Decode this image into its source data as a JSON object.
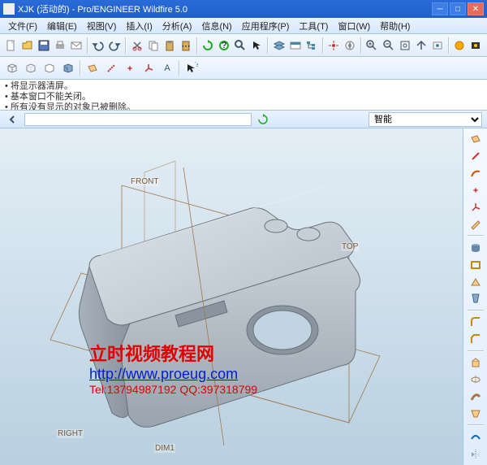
{
  "title": "XJK (活动的) - Pro/ENGINEER Wildfire 5.0",
  "menu": [
    "文件(F)",
    "编辑(E)",
    "视图(V)",
    "插入(I)",
    "分析(A)",
    "信息(N)",
    "应用程序(P)",
    "工具(T)",
    "窗口(W)",
    "帮助(H)"
  ],
  "messages": [
    "将显示器清屏。",
    "基本窗口不能关闭。",
    "所有没有显示的对象已被删除。"
  ],
  "filter_select": "智能",
  "datum": {
    "front": "FRONT",
    "top": "TOP",
    "right": "RIGHT",
    "dim1": "DIM1"
  },
  "watermark": {
    "line1": "立时视频教程网",
    "line2": "http://www.proeug.com",
    "line3": "Tel:13794987192    QQ:397318799"
  },
  "winbtns": {
    "min": "─",
    "max": "□",
    "close": "✕"
  }
}
